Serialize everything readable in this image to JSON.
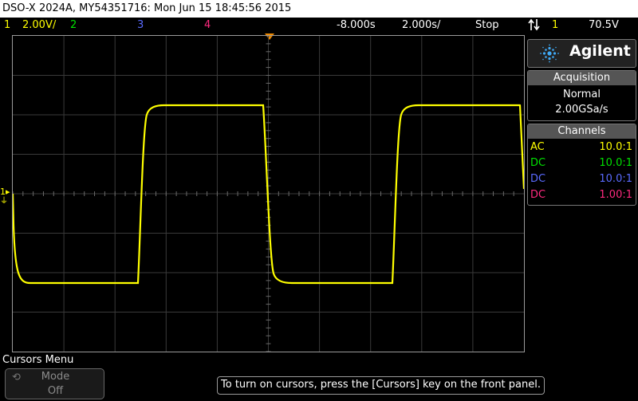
{
  "title": "DSO-X 2024A, MY54351716: Mon Jun 15 18:45:56 2015",
  "status": {
    "ch1_num": "1",
    "ch1_scale": "2.00V/",
    "ch2_num": "2",
    "ch3_num": "3",
    "ch4_num": "4",
    "time_offset": "-8.000s",
    "time_scale": "2.000s/",
    "run_state": "Stop",
    "trigger_icon": "trigger-edge-icon",
    "trigger_source": "1",
    "trigger_level": "70.5V"
  },
  "brand": {
    "logo": "Agilent"
  },
  "acquisition": {
    "header": "Acquisition",
    "mode": "Normal",
    "rate": "2.00GSa/s"
  },
  "channels": {
    "header": "Channels",
    "rows": [
      {
        "coupling": "AC",
        "probe": "10.0:1",
        "color": "#ffff00"
      },
      {
        "coupling": "DC",
        "probe": "10.0:1",
        "color": "#00e000"
      },
      {
        "coupling": "DC",
        "probe": "10.0:1",
        "color": "#5a6bff"
      },
      {
        "coupling": "DC",
        "probe": "1.00:1",
        "color": "#ff2a7f"
      }
    ]
  },
  "ground_marker": "1",
  "menu": {
    "title": "Cursors Menu",
    "softkey_label": "Mode",
    "softkey_value": "Off",
    "softkey_icon": "rotate-knob-icon"
  },
  "hint": "To turn on cursors, press the [Cursors] key on the front panel.",
  "colors": {
    "ch1": "#ffff00",
    "ch2": "#00e000",
    "ch3": "#5a6bff",
    "ch4": "#ff2a7f",
    "trigger": "#f08a00"
  }
}
